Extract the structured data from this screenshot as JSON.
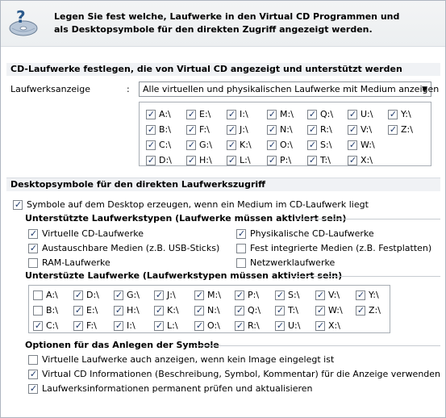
{
  "header": {
    "icon": "cd-question-icon",
    "text": "Legen Sie fest welche, Laufwerke in den Virtual CD Programmen und als Desktopsymbole für den direkten Zugriff angezeigt werden."
  },
  "section1": {
    "title": "CD-Laufwerke festlegen, die von Virtual CD angezeigt und unterstützt werden",
    "field_label": "Laufwerksanzeige",
    "colon": ":",
    "combo_value": "Alle virtuellen und physikalischen Laufwerke mit Medium anzeigen",
    "drives": [
      {
        "label": "A:\\",
        "checked": true
      },
      {
        "label": "E:\\",
        "checked": true
      },
      {
        "label": "I:\\",
        "checked": true
      },
      {
        "label": "M:\\",
        "checked": true
      },
      {
        "label": "Q:\\",
        "checked": true
      },
      {
        "label": "U:\\",
        "checked": true
      },
      {
        "label": "Y:\\",
        "checked": true
      },
      {
        "label": "B:\\",
        "checked": true
      },
      {
        "label": "F:\\",
        "checked": true
      },
      {
        "label": "J:\\",
        "checked": true
      },
      {
        "label": "N:\\",
        "checked": true
      },
      {
        "label": "R:\\",
        "checked": true
      },
      {
        "label": "V:\\",
        "checked": true
      },
      {
        "label": "Z:\\",
        "checked": true
      },
      {
        "label": "C:\\",
        "checked": true
      },
      {
        "label": "G:\\",
        "checked": true
      },
      {
        "label": "K:\\",
        "checked": true
      },
      {
        "label": "O:\\",
        "checked": true
      },
      {
        "label": "S:\\",
        "checked": true
      },
      {
        "label": "W:\\",
        "checked": true
      },
      {
        "label": "",
        "checked": false
      },
      {
        "label": "D:\\",
        "checked": true
      },
      {
        "label": "H:\\",
        "checked": true
      },
      {
        "label": "L:\\",
        "checked": true
      },
      {
        "label": "P:\\",
        "checked": true
      },
      {
        "label": "T:\\",
        "checked": true
      },
      {
        "label": "X:\\",
        "checked": true
      },
      {
        "label": "",
        "checked": false
      }
    ]
  },
  "section2": {
    "title": "Desktopsymbole für den direkten Laufwerkszugriff",
    "create_symbols": {
      "label": "Symbole auf dem Desktop erzeugen, wenn ein Medium im CD-Laufwerk liegt",
      "checked": true
    },
    "types_heading": "Unterstützte Laufwerkstypen (Laufwerke müssen aktiviert sein)",
    "types": [
      {
        "label": "Virtuelle CD-Laufwerke",
        "checked": true
      },
      {
        "label": "Physikalische CD-Laufwerke",
        "checked": true
      },
      {
        "label": "Austauschbare Medien (z.B. USB-Sticks)",
        "checked": true
      },
      {
        "label": "Fest integrierte Medien (z.B. Festplatten)",
        "checked": false
      },
      {
        "label": "RAM-Laufwerke",
        "checked": false
      },
      {
        "label": "Netzwerklaufwerke",
        "checked": false
      }
    ],
    "drives_heading": "Unterstüzte Laufwerke (Laufwerkstypen müssen aktiviert sein)",
    "drives": [
      {
        "label": "A:\\",
        "checked": false
      },
      {
        "label": "D:\\",
        "checked": true
      },
      {
        "label": "G:\\",
        "checked": true
      },
      {
        "label": "J:\\",
        "checked": true
      },
      {
        "label": "M:\\",
        "checked": true
      },
      {
        "label": "P:\\",
        "checked": true
      },
      {
        "label": "S:\\",
        "checked": true
      },
      {
        "label": "V:\\",
        "checked": true
      },
      {
        "label": "Y:\\",
        "checked": true
      },
      {
        "label": "B:\\",
        "checked": false
      },
      {
        "label": "E:\\",
        "checked": true
      },
      {
        "label": "H:\\",
        "checked": true
      },
      {
        "label": "K:\\",
        "checked": true
      },
      {
        "label": "N:\\",
        "checked": true
      },
      {
        "label": "Q:\\",
        "checked": true
      },
      {
        "label": "T:\\",
        "checked": true
      },
      {
        "label": "W:\\",
        "checked": true
      },
      {
        "label": "Z:\\",
        "checked": true
      },
      {
        "label": "C:\\",
        "checked": true
      },
      {
        "label": "F:\\",
        "checked": true
      },
      {
        "label": "I:\\",
        "checked": true
      },
      {
        "label": "L:\\",
        "checked": true
      },
      {
        "label": "O:\\",
        "checked": true
      },
      {
        "label": "R:\\",
        "checked": true
      },
      {
        "label": "U:\\",
        "checked": true
      },
      {
        "label": "X:\\",
        "checked": true
      },
      {
        "label": "",
        "checked": false
      }
    ],
    "options_heading": "Optionen für das Anlegen der Symbole",
    "options": [
      {
        "label": "Virtuelle Laufwerke auch anzeigen, wenn kein Image eingelegt ist",
        "checked": false
      },
      {
        "label": "Virtual CD Informationen (Beschreibung, Symbol, Kommentar) für die Anzeige verwenden",
        "checked": true
      },
      {
        "label": "Laufwerksinformationen permanent prüfen und aktualisieren",
        "checked": true
      }
    ]
  },
  "colors": {
    "section_bar": "#f0f2f5",
    "check_mark": "#1f3a6b",
    "border": "#aeb6c0"
  }
}
